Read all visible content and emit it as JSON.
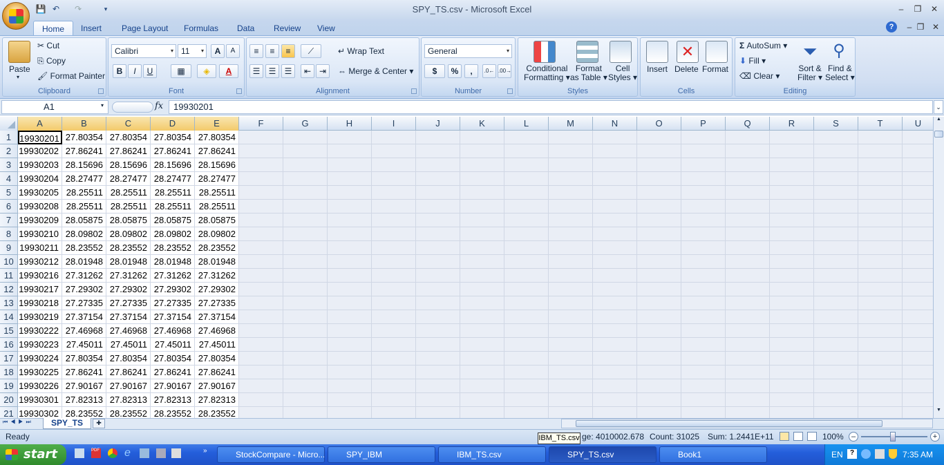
{
  "window": {
    "title": "SPY_TS.csv - Microsoft Excel"
  },
  "qat": {
    "save_icon": "save-icon",
    "undo_icon": "undo-icon",
    "redo_icon": "redo-icon",
    "customize_icon": "chevron-down-icon"
  },
  "tabs": [
    "Home",
    "Insert",
    "Page Layout",
    "Formulas",
    "Data",
    "Review",
    "View"
  ],
  "ribbon": {
    "clipboard": {
      "label": "Clipboard",
      "paste": "Paste",
      "cut": "Cut",
      "copy": "Copy",
      "format_painter": "Format Painter"
    },
    "font": {
      "label": "Font",
      "font_name": "Calibri",
      "font_size": "11",
      "bold": "B",
      "italic": "I",
      "underline": "U",
      "grow": "A",
      "shrink": "A",
      "font_color": "A"
    },
    "alignment": {
      "label": "Alignment",
      "wrap_text": "Wrap Text",
      "merge_center": "Merge & Center"
    },
    "number": {
      "label": "Number",
      "format": "General",
      "currency": "$",
      "percent": "%",
      "comma": ","
    },
    "styles": {
      "label": "Styles",
      "conditional1": "Conditional",
      "conditional2": "Formatting",
      "format_table1": "Format",
      "format_table2": "as Table",
      "cell_styles1": "Cell",
      "cell_styles2": "Styles"
    },
    "cells": {
      "label": "Cells",
      "insert": "Insert",
      "delete": "Delete",
      "format": "Format"
    },
    "editing": {
      "label": "Editing",
      "autosum": "AutoSum",
      "fill": "Fill",
      "clear": "Clear",
      "sort1": "Sort &",
      "sort2": "Filter",
      "find1": "Find &",
      "find2": "Select"
    }
  },
  "formula_bar": {
    "name_box": "A1",
    "fx": "fx",
    "value": "19930201"
  },
  "columns": [
    "A",
    "B",
    "C",
    "D",
    "E",
    "F",
    "G",
    "H",
    "I",
    "J",
    "K",
    "L",
    "M",
    "N",
    "O",
    "P",
    "Q",
    "R",
    "S",
    "T",
    "U"
  ],
  "rows": [
    [
      "1",
      "19930201",
      "27.80354",
      "27.80354",
      "27.80354",
      "27.80354"
    ],
    [
      "2",
      "19930202",
      "27.86241",
      "27.86241",
      "27.86241",
      "27.86241"
    ],
    [
      "3",
      "19930203",
      "28.15696",
      "28.15696",
      "28.15696",
      "28.15696"
    ],
    [
      "4",
      "19930204",
      "28.27477",
      "28.27477",
      "28.27477",
      "28.27477"
    ],
    [
      "5",
      "19930205",
      "28.25511",
      "28.25511",
      "28.25511",
      "28.25511"
    ],
    [
      "6",
      "19930208",
      "28.25511",
      "28.25511",
      "28.25511",
      "28.25511"
    ],
    [
      "7",
      "19930209",
      "28.05875",
      "28.05875",
      "28.05875",
      "28.05875"
    ],
    [
      "8",
      "19930210",
      "28.09802",
      "28.09802",
      "28.09802",
      "28.09802"
    ],
    [
      "9",
      "19930211",
      "28.23552",
      "28.23552",
      "28.23552",
      "28.23552"
    ],
    [
      "10",
      "19930212",
      "28.01948",
      "28.01948",
      "28.01948",
      "28.01948"
    ],
    [
      "11",
      "19930216",
      "27.31262",
      "27.31262",
      "27.31262",
      "27.31262"
    ],
    [
      "12",
      "19930217",
      "27.29302",
      "27.29302",
      "27.29302",
      "27.29302"
    ],
    [
      "13",
      "19930218",
      "27.27335",
      "27.27335",
      "27.27335",
      "27.27335"
    ],
    [
      "14",
      "19930219",
      "27.37154",
      "27.37154",
      "27.37154",
      "27.37154"
    ],
    [
      "15",
      "19930222",
      "27.46968",
      "27.46968",
      "27.46968",
      "27.46968"
    ],
    [
      "16",
      "19930223",
      "27.45011",
      "27.45011",
      "27.45011",
      "27.45011"
    ],
    [
      "17",
      "19930224",
      "27.80354",
      "27.80354",
      "27.80354",
      "27.80354"
    ],
    [
      "18",
      "19930225",
      "27.86241",
      "27.86241",
      "27.86241",
      "27.86241"
    ],
    [
      "19",
      "19930226",
      "27.90167",
      "27.90167",
      "27.90167",
      "27.90167"
    ],
    [
      "20",
      "19930301",
      "27.82313",
      "27.82313",
      "27.82313",
      "27.82313"
    ],
    [
      "21",
      "19930302",
      "28.23552",
      "28.23552",
      "28.23552",
      "28.23552"
    ]
  ],
  "sheet_tab": "SPY_TS",
  "status": {
    "ready": "Ready",
    "average": "ge: 4010002.678",
    "count": "Count: 31025",
    "sum": "Sum: 1.2441E+11",
    "zoom": "100%",
    "tooltip": "IBM_TS.csv"
  },
  "taskbar": {
    "start": "start",
    "buttons": [
      "StockCompare - Micro...",
      "SPY_IBM",
      "IBM_TS.csv",
      "SPY_TS.csv",
      "Book1"
    ],
    "lang": "EN",
    "time": "7:35 AM"
  },
  "colors": {
    "accent": "#15428b",
    "grid": "#d0d7e5",
    "taskbar": "#245edb"
  }
}
